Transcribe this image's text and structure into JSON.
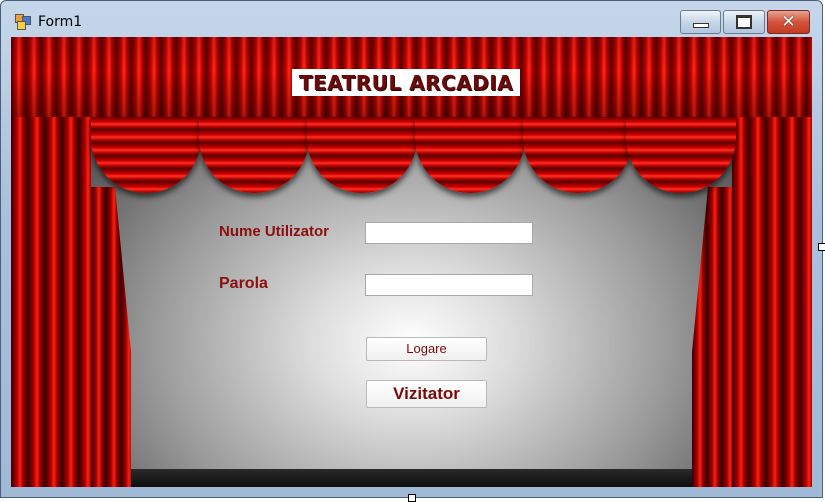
{
  "window": {
    "title": "Form1",
    "controls": {
      "minimize": "minimize",
      "maximize": "maximize",
      "close": "✕"
    }
  },
  "banner": {
    "title": "TEATRUL ARCADIA"
  },
  "form": {
    "username_label": "Nume Utilizator",
    "username_value": "",
    "password_label": "Parola",
    "password_value": "",
    "login_button": "Logare",
    "visitor_button": "Vizitator"
  },
  "icons": {
    "app": "windows-form-icon",
    "minimize": "minimize-icon",
    "maximize": "maximize-icon",
    "close": "close-icon"
  },
  "colors": {
    "curtain_red": "#c40000",
    "label_text": "#8b0f0f",
    "banner_text": "#6a0a0a",
    "close_button": "#c43b22"
  }
}
